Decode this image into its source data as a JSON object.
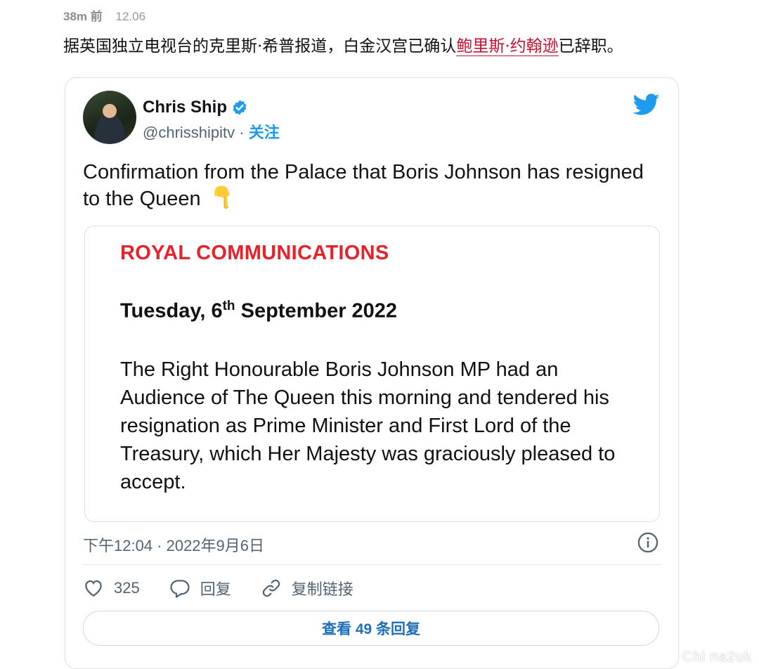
{
  "post": {
    "time_ago": "38m 前",
    "date": "12.06",
    "headline_before": "据英国独立电视台的克里斯·希普报道，白金汉宫已确认",
    "headline_link": "鲍里斯·约翰逊",
    "headline_after": "已辞职。"
  },
  "tweet": {
    "author_name": "Chris Ship",
    "handle": "@chrisshipitv",
    "separator": " · ",
    "follow_label": "关注",
    "text": "Confirmation from the Palace that Boris Johnson has resigned to the Queen",
    "emoji": "backhand-index-pointing-down",
    "document": {
      "title": "ROYAL COMMUNICATIONS",
      "date_prefix": "Tuesday, 6",
      "date_suffix": "th",
      "date_rest": " September 2022",
      "body": "The Right Honourable Boris Johnson MP had an Audience of The Queen this morning and tendered his resignation as Prime Minister and First Lord of the Treasury, which Her Majesty was graciously pleased to accept."
    },
    "timestamp": "下午12:04 · 2022年9月6日",
    "likes": "325",
    "reply_label": "回复",
    "copy_link_label": "复制链接",
    "view_replies_label": "查看 49 条回复"
  },
  "watermark": "Chi na2uk",
  "colors": {
    "twitter_blue": "#1d9bf0",
    "headline_link": "#c8102e",
    "doc_title_red": "#e8222b"
  }
}
